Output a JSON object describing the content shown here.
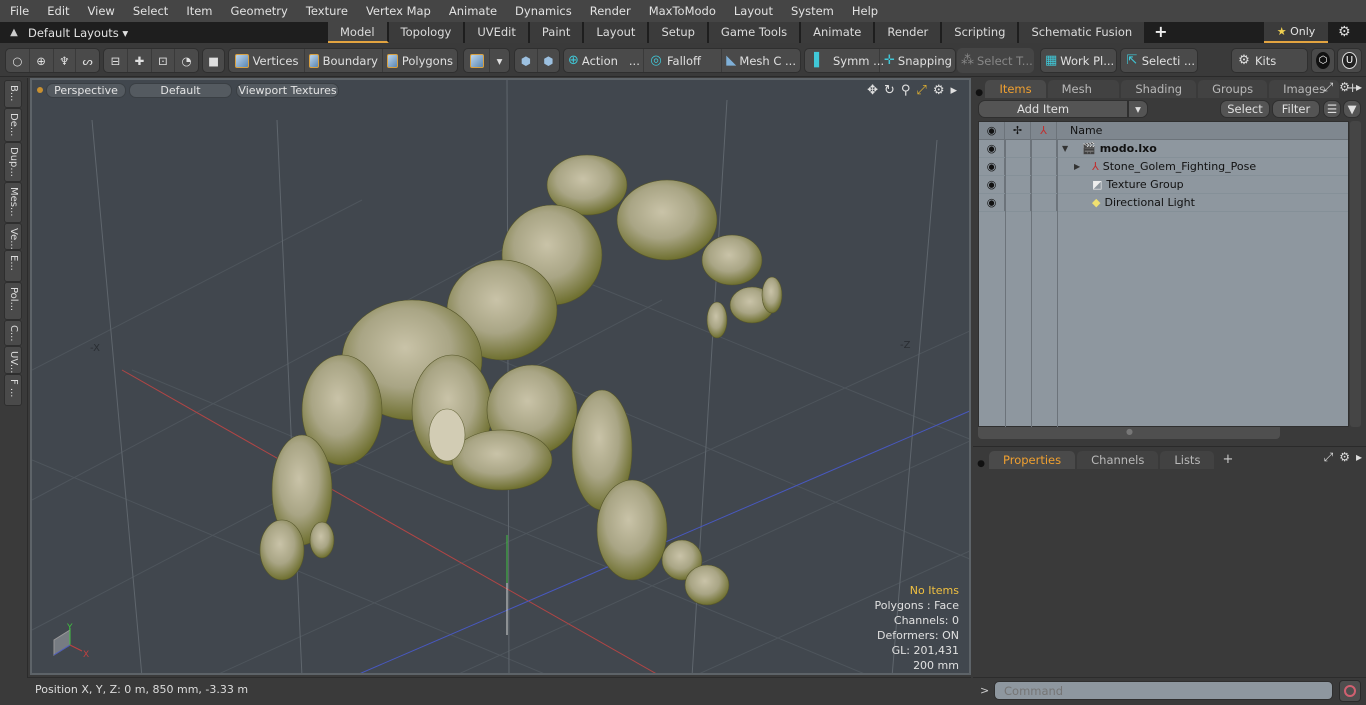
{
  "menu": [
    "File",
    "Edit",
    "View",
    "Select",
    "Item",
    "Geometry",
    "Texture",
    "Vertex Map",
    "Animate",
    "Dynamics",
    "Render",
    "MaxToModo",
    "Layout",
    "System",
    "Help"
  ],
  "layouts": {
    "dropdown_label": "Default Layouts",
    "tabs": [
      "Model",
      "Topology",
      "UVEdit",
      "Paint",
      "Layout",
      "Setup",
      "Game Tools",
      "Animate",
      "Render",
      "Scripting",
      "Schematic Fusion"
    ],
    "active_tab": "Model",
    "add_tab": "+",
    "only_label": "Only"
  },
  "toolbar": {
    "vertices": "Vertices",
    "boundary": "Boundary",
    "polygons": "Polygons",
    "action": "Action",
    "action_more": "...",
    "falloff": "Falloff",
    "mesh": "Mesh C ...",
    "symmetry": "Symm ...",
    "snapping": "Snapping",
    "select_tool": "Select T...",
    "work_plane": "Work Pl...",
    "selection": "Selecti ...",
    "kits": "Kits"
  },
  "left_tabs": [
    "B...",
    "De...",
    "Dup...",
    "Mes...",
    "Ve...",
    "E...",
    "Pol...",
    "C...",
    "UV...",
    "F ..."
  ],
  "viewport": {
    "view": "Perspective",
    "shading": "Default",
    "textures": "Viewport Textures",
    "axis_neg_x": "-X",
    "axis_neg_z": "-Z",
    "gizmo_y": "Y",
    "gizmo_x": "X",
    "stats": {
      "items": "No Items",
      "polygons": "Polygons : Face",
      "channels": "Channels: 0",
      "deformers": "Deformers: ON",
      "gl": "GL: 201,431",
      "scale": "200 mm"
    }
  },
  "status": {
    "position": "Position X, Y, Z:   0 m, 850 mm, -3.33 m"
  },
  "items_panel": {
    "tabs": [
      "Items",
      "Mesh Ops",
      "Shading",
      "Groups",
      "Images"
    ],
    "active_tab": "Items",
    "add_item": "Add Item",
    "select": "Select",
    "filter": "Filter",
    "column_name": "Name",
    "rows": [
      {
        "name": "modo.lxo",
        "icon": "scene-icon",
        "bold": true
      },
      {
        "name": "Stone_Golem_Fighting_Pose",
        "icon": "locator-icon"
      },
      {
        "name": "Texture Group",
        "icon": "texture-group-icon"
      },
      {
        "name": "Directional Light",
        "icon": "light-icon"
      }
    ]
  },
  "properties_panel": {
    "tabs": [
      "Properties",
      "Channels",
      "Lists"
    ],
    "active_tab": "Properties"
  },
  "command": {
    "prompt": ">",
    "placeholder": "Command"
  }
}
